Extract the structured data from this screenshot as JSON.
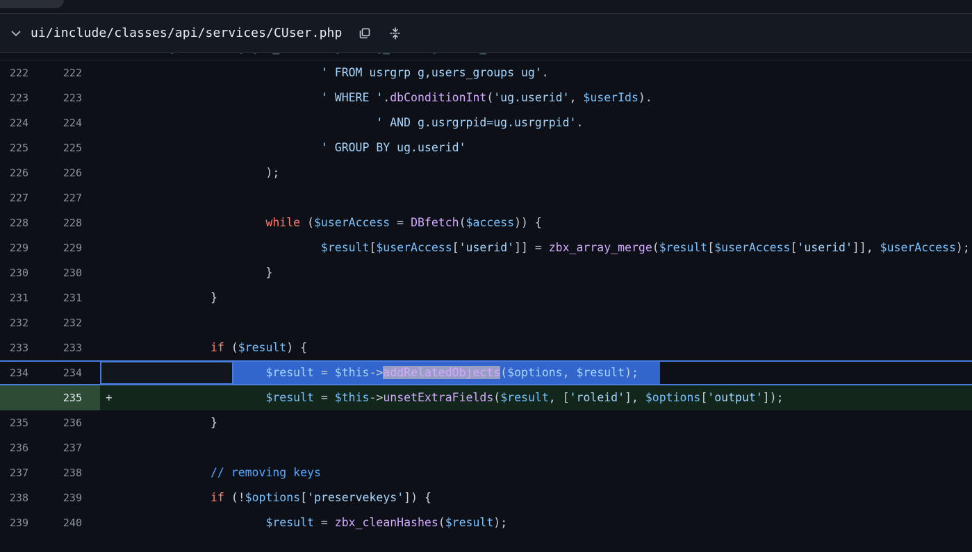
{
  "header": {
    "file_path": "ui/include/classes/api/services/CUser.php",
    "chevron_icon": "chevron-down-icon",
    "copy_icon": "copy-icon",
    "collapse_icon": "collapse-expand-icon"
  },
  "colors": {
    "background": "#0d1117",
    "header_background": "#151a22",
    "added_row_background": "#12261c",
    "added_gutter_background": "#2e4b36",
    "focus_border": "#4a7ddb",
    "selection_background": "#3366cc",
    "text_selection": "#9a9ec4",
    "gutter_text": "#8b949e",
    "string": "#a5d6ff",
    "function": "#d2a8ff",
    "variable": "#79c0ff",
    "keyword": "#ff7b72",
    "comment": "#58a6ff",
    "plain": "#c9d1d9"
  },
  "diff": {
    "clipped_top_line": "' SELECT ug.userid, g.gui_access, g.debug_mode, g.users_status",
    "rows": [
      {
        "old": "222",
        "new": "222",
        "marker": "",
        "type": "context",
        "tokens": [
          {
            "t": "                                ",
            "c": "plain"
          },
          {
            "t": "' FROM usrgrp g,users_groups ug'",
            "c": "string"
          },
          {
            "t": ".",
            "c": "plain"
          }
        ]
      },
      {
        "old": "223",
        "new": "223",
        "marker": "",
        "type": "context",
        "tokens": [
          {
            "t": "                                ",
            "c": "plain"
          },
          {
            "t": "' WHERE '",
            "c": "string"
          },
          {
            "t": ".",
            "c": "plain"
          },
          {
            "t": "dbConditionInt",
            "c": "function"
          },
          {
            "t": "(",
            "c": "plain"
          },
          {
            "t": "'ug.userid'",
            "c": "string"
          },
          {
            "t": ", ",
            "c": "plain"
          },
          {
            "t": "$userIds",
            "c": "variable"
          },
          {
            "t": ").",
            "c": "plain"
          }
        ]
      },
      {
        "old": "224",
        "new": "224",
        "marker": "",
        "type": "context",
        "tokens": [
          {
            "t": "                                        ",
            "c": "plain"
          },
          {
            "t": "' AND g.usrgrpid=ug.usrgrpid'",
            "c": "string"
          },
          {
            "t": ".",
            "c": "plain"
          }
        ]
      },
      {
        "old": "225",
        "new": "225",
        "marker": "",
        "type": "context",
        "tokens": [
          {
            "t": "                                ",
            "c": "plain"
          },
          {
            "t": "' GROUP BY ug.userid'",
            "c": "string"
          }
        ]
      },
      {
        "old": "226",
        "new": "226",
        "marker": "",
        "type": "context",
        "tokens": [
          {
            "t": "                        );",
            "c": "plain"
          }
        ]
      },
      {
        "old": "227",
        "new": "227",
        "marker": "",
        "type": "context",
        "tokens": []
      },
      {
        "old": "228",
        "new": "228",
        "marker": "",
        "type": "context",
        "tokens": [
          {
            "t": "                        ",
            "c": "plain"
          },
          {
            "t": "while",
            "c": "keyword"
          },
          {
            "t": " (",
            "c": "plain"
          },
          {
            "t": "$userAccess",
            "c": "variable"
          },
          {
            "t": " = ",
            "c": "plain"
          },
          {
            "t": "DBfetch",
            "c": "function"
          },
          {
            "t": "(",
            "c": "plain"
          },
          {
            "t": "$access",
            "c": "variable"
          },
          {
            "t": ")) {",
            "c": "plain"
          }
        ]
      },
      {
        "old": "229",
        "new": "229",
        "marker": "",
        "type": "context",
        "tokens": [
          {
            "t": "                                ",
            "c": "plain"
          },
          {
            "t": "$result",
            "c": "variable"
          },
          {
            "t": "[",
            "c": "plain"
          },
          {
            "t": "$userAccess",
            "c": "variable"
          },
          {
            "t": "[",
            "c": "plain"
          },
          {
            "t": "'userid'",
            "c": "string"
          },
          {
            "t": "]] = ",
            "c": "plain"
          },
          {
            "t": "zbx_array_merge",
            "c": "function"
          },
          {
            "t": "(",
            "c": "plain"
          },
          {
            "t": "$result",
            "c": "variable"
          },
          {
            "t": "[",
            "c": "plain"
          },
          {
            "t": "$userAccess",
            "c": "variable"
          },
          {
            "t": "[",
            "c": "plain"
          },
          {
            "t": "'userid'",
            "c": "string"
          },
          {
            "t": "]], ",
            "c": "plain"
          },
          {
            "t": "$userAccess",
            "c": "variable"
          },
          {
            "t": ");",
            "c": "plain"
          }
        ]
      },
      {
        "old": "230",
        "new": "230",
        "marker": "",
        "type": "context",
        "tokens": [
          {
            "t": "                        }",
            "c": "plain"
          }
        ]
      },
      {
        "old": "231",
        "new": "231",
        "marker": "",
        "type": "context",
        "tokens": [
          {
            "t": "                }",
            "c": "plain"
          }
        ]
      },
      {
        "old": "232",
        "new": "232",
        "marker": "",
        "type": "context",
        "tokens": []
      },
      {
        "old": "233",
        "new": "233",
        "marker": "",
        "type": "context",
        "tokens": [
          {
            "t": "                ",
            "c": "plain"
          },
          {
            "t": "if",
            "c": "keyword"
          },
          {
            "t": " (",
            "c": "plain"
          },
          {
            "t": "$result",
            "c": "variable"
          },
          {
            "t": ") {",
            "c": "plain"
          }
        ]
      },
      {
        "old": "234",
        "new": "234",
        "marker": "",
        "type": "focus",
        "selected_text": "addRelatedObjects",
        "tokens": [
          {
            "t": "                        ",
            "c": "plain"
          },
          {
            "t": "$result",
            "c": "variable"
          },
          {
            "t": " = ",
            "c": "plain"
          },
          {
            "t": "$this",
            "c": "variable"
          },
          {
            "t": "->",
            "c": "plain"
          },
          {
            "t": "addRelatedObjects",
            "c": "selected"
          },
          {
            "t": "(",
            "c": "plain"
          },
          {
            "t": "$options",
            "c": "variable"
          },
          {
            "t": ", ",
            "c": "plain"
          },
          {
            "t": "$result",
            "c": "variable"
          },
          {
            "t": ");",
            "c": "plain"
          }
        ]
      },
      {
        "old": "",
        "new": "235",
        "marker": "+",
        "type": "added",
        "tokens": [
          {
            "t": "                        ",
            "c": "plain"
          },
          {
            "t": "$result",
            "c": "variable"
          },
          {
            "t": " = ",
            "c": "plain"
          },
          {
            "t": "$this",
            "c": "variable"
          },
          {
            "t": "->",
            "c": "plain"
          },
          {
            "t": "unsetExtraFields",
            "c": "function"
          },
          {
            "t": "(",
            "c": "plain"
          },
          {
            "t": "$result",
            "c": "variable"
          },
          {
            "t": ", [",
            "c": "plain"
          },
          {
            "t": "'roleid'",
            "c": "string"
          },
          {
            "t": "], ",
            "c": "plain"
          },
          {
            "t": "$options",
            "c": "variable"
          },
          {
            "t": "[",
            "c": "plain"
          },
          {
            "t": "'output'",
            "c": "string"
          },
          {
            "t": "]);",
            "c": "plain"
          }
        ]
      },
      {
        "old": "235",
        "new": "236",
        "marker": "",
        "type": "context",
        "tokens": [
          {
            "t": "                }",
            "c": "plain"
          }
        ]
      },
      {
        "old": "236",
        "new": "237",
        "marker": "",
        "type": "context",
        "tokens": []
      },
      {
        "old": "237",
        "new": "238",
        "marker": "",
        "type": "context",
        "tokens": [
          {
            "t": "                ",
            "c": "plain"
          },
          {
            "t": "// removing keys",
            "c": "comment"
          }
        ]
      },
      {
        "old": "238",
        "new": "239",
        "marker": "",
        "type": "context",
        "tokens": [
          {
            "t": "                ",
            "c": "plain"
          },
          {
            "t": "if",
            "c": "keyword"
          },
          {
            "t": " (!",
            "c": "plain"
          },
          {
            "t": "$options",
            "c": "variable"
          },
          {
            "t": "[",
            "c": "plain"
          },
          {
            "t": "'preservekeys'",
            "c": "string"
          },
          {
            "t": "]) {",
            "c": "plain"
          }
        ]
      },
      {
        "old": "239",
        "new": "240",
        "marker": "",
        "type": "context",
        "tokens": [
          {
            "t": "                        ",
            "c": "plain"
          },
          {
            "t": "$result",
            "c": "variable"
          },
          {
            "t": " = ",
            "c": "plain"
          },
          {
            "t": "zbx_cleanHashes",
            "c": "function"
          },
          {
            "t": "(",
            "c": "plain"
          },
          {
            "t": "$result",
            "c": "variable"
          },
          {
            "t": ");",
            "c": "plain"
          }
        ]
      }
    ]
  }
}
